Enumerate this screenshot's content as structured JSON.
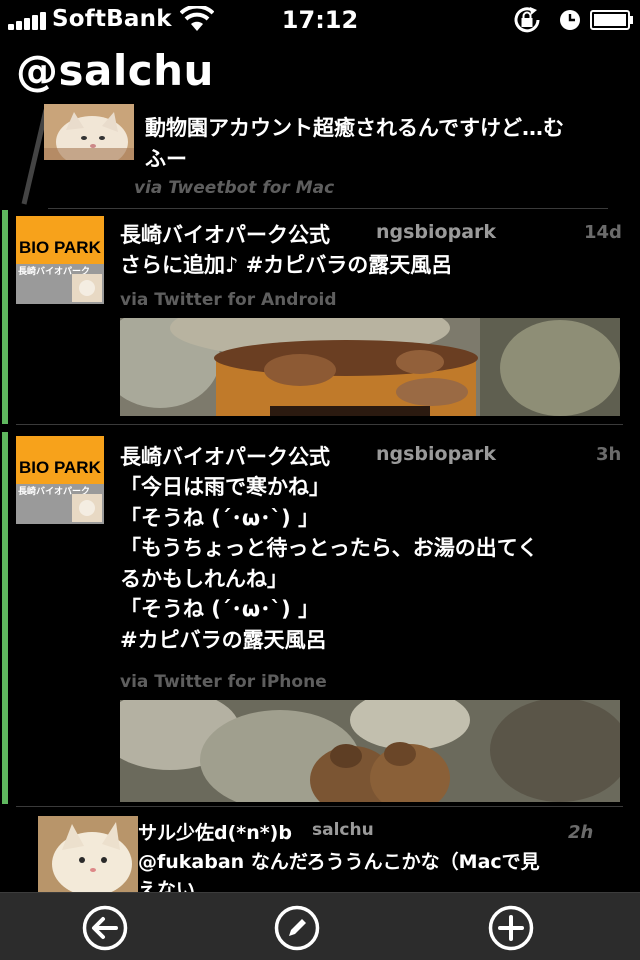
{
  "status_bar": {
    "carrier": "SoftBank",
    "time": "17:12",
    "icons": [
      "signal-icon",
      "wifi-icon",
      "rotation-lock-icon",
      "alarm-icon",
      "battery-icon"
    ]
  },
  "header": {
    "title": "@salchu"
  },
  "tweets": [
    {
      "text": "動物園アカウント超癒されるんですけど…む\nふー",
      "via": "via Tweetbot for Mac"
    },
    {
      "name": "長崎バイオパーク公式",
      "handle": "ngsbiopark",
      "ago": "14d",
      "text": "さらに追加♪ #カピバラの露天風呂",
      "via": "via Twitter for Android",
      "avatar_text": [
        "BIO PARK",
        "長崎バイオパーク"
      ]
    },
    {
      "name": "長崎バイオパーク公式",
      "handle": "ngsbiopark",
      "ago": "3h",
      "text": "「今日は雨で寒かね」\n「そうね (´･ω･`) 」\n「もうちょっと待っとったら、お湯の出てく\nるかもしれんね」\n「そうね (´･ω･`) 」\n#カピバラの露天風呂",
      "via": "via Twitter for iPhone",
      "avatar_text": [
        "BIO PARK",
        "長崎バイオパーク"
      ]
    },
    {
      "name": "サル少佐d(*n*)b",
      "handle": "salchu",
      "ago": "2h",
      "text": "@fukaban なんだろううんこかな（Macで見\nえない"
    }
  ],
  "toolbar": {
    "items": [
      "back-icon",
      "compose-icon",
      "add-icon"
    ]
  },
  "colors": {
    "accent": "#5fb85f",
    "background": "#000000",
    "toolbar": "#2c2c2c",
    "bio_park_yellow": "#f7a21b"
  }
}
